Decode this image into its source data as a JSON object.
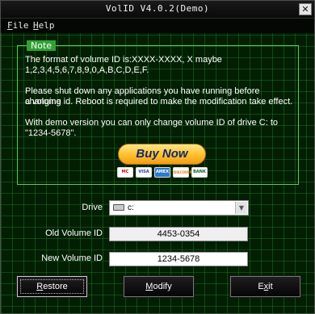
{
  "window": {
    "title": "VolID V4.0.2(Demo)",
    "close_symbol": "✕"
  },
  "menu": {
    "file": {
      "accel": "F",
      "rest": "ile"
    },
    "help": {
      "accel": "H",
      "rest": "elp"
    }
  },
  "note": {
    "tag": "Note",
    "para1_line1": "The format of volume ID is:XXXX-XXXX, X maybe",
    "para1_line2": "1,2,3,4,5,6,7,8,9,0,A,B,C,D,E,F.",
    "para2_line1": "Please shut down any applications you have running before changing",
    "para2_line2": "a volume id. Reboot is required to make the modification take effect.",
    "para3_line1": "With demo version you can only change volume ID of drive C: to",
    "para3_line2": "\"1234-5678\"."
  },
  "buy_now": {
    "label": "Buy Now",
    "cards": [
      "MC",
      "VISA",
      "AMEX",
      "DISCOVER",
      "BANK"
    ]
  },
  "form": {
    "drive_label": "Drive",
    "drive_value": "c:",
    "old_label": "Old Volume ID",
    "old_value": "4453-0354",
    "new_label": "New Volume ID",
    "new_value": "1234-5678"
  },
  "buttons": {
    "restore": {
      "accel": "R",
      "rest": "estore"
    },
    "modify": {
      "accel": "M",
      "rest": "odify"
    },
    "exit": {
      "accel": "x",
      "pre": "E",
      "rest": "it"
    }
  },
  "colors": {
    "background": "#031f03",
    "grid": "#289632",
    "note_border": "#58c85c",
    "buy_now": "#ffbf2d"
  }
}
